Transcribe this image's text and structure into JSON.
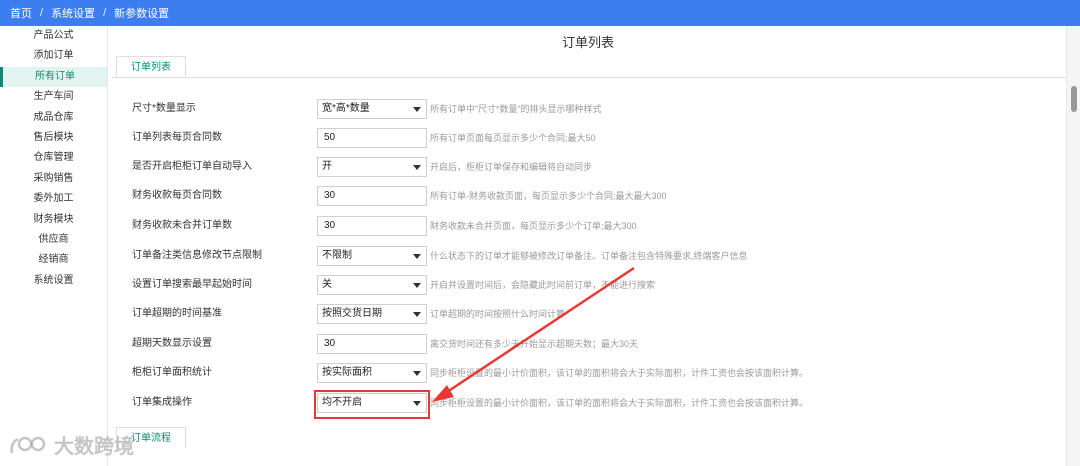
{
  "breadcrumb": {
    "home": "首页",
    "settings": "系统设置",
    "current": "新参数设置",
    "separator": "/"
  },
  "sidebar": {
    "items": [
      {
        "label": "产品公式"
      },
      {
        "label": "添加订单"
      },
      {
        "label": "所有订单",
        "active": true
      },
      {
        "label": "生产车间"
      },
      {
        "label": "成品仓库"
      },
      {
        "label": "售后模块"
      },
      {
        "label": "仓库管理"
      },
      {
        "label": "采购销售"
      },
      {
        "label": "委外加工"
      },
      {
        "label": "财务模块"
      },
      {
        "label": "供应商"
      },
      {
        "label": "经销商"
      },
      {
        "label": "系统设置"
      }
    ]
  },
  "page": {
    "title": "订单列表",
    "tab_order_list": "订单列表",
    "tab_order_flow": "订单流程"
  },
  "settings": [
    {
      "label": "尺寸*数量显示",
      "type": "select",
      "value": "宽*高*数量",
      "hint": "所有订单中“尺寸*数量”的排头显示哪种样式"
    },
    {
      "label": "订单列表每页合同数",
      "type": "input",
      "value": "50",
      "hint": "所有订单页面每页显示多少个合同;最大50"
    },
    {
      "label": "是否开启柜柜订单自动导入",
      "type": "select",
      "value": "开",
      "hint": "开启后，柜柜订单保存和编辑将自动同步"
    },
    {
      "label": "财务收款每页合同数",
      "type": "input",
      "value": "30",
      "hint": "所有订单-财务收款页面，每页显示多少个合同;最大最大300"
    },
    {
      "label": "财务收款未合并订单数",
      "type": "input",
      "value": "30",
      "hint": "财务收款未合并页面，每页显示多少个订单;最大300"
    },
    {
      "label": "订单备注类信息修改节点限制",
      "type": "select",
      "value": "不限制",
      "hint": "什么状态下的订单才能够被修改订单备注。订单备注包含特殊要求,终端客户信息"
    },
    {
      "label": "设置订单搜索最早起始时间",
      "type": "select",
      "value": "关",
      "hint": "开启并设置时间后，会隐藏此时间前订单，不能进行搜索"
    },
    {
      "label": "订单超期的时间基准",
      "type": "select",
      "value": "按照交货日期",
      "hint": "订单超期的时间按照什么时间计算"
    },
    {
      "label": "超期天数显示设置",
      "type": "input",
      "value": "30",
      "hint": "离交货时间还有多少天开始显示超期天数；最大30天"
    },
    {
      "label": "柜柜订单面积统计",
      "type": "select",
      "value": "按实际面积",
      "hint": "同步柜柜设置的最小计价面积，该订单的面积将会大于实际面积，计件工资也会按该面积计算。"
    },
    {
      "label": "订单集成操作",
      "type": "select",
      "value": "均不开启",
      "hint": "同步柜柜设置的最小计价面积，该订单的面积将会大于实际面积，计件工资也会按该面积计算。"
    }
  ],
  "watermark": {
    "text": "大数跨境"
  },
  "colors": {
    "topbar": "#3c7ef0",
    "accent": "#0a8b72",
    "annotation": "#e53935"
  }
}
